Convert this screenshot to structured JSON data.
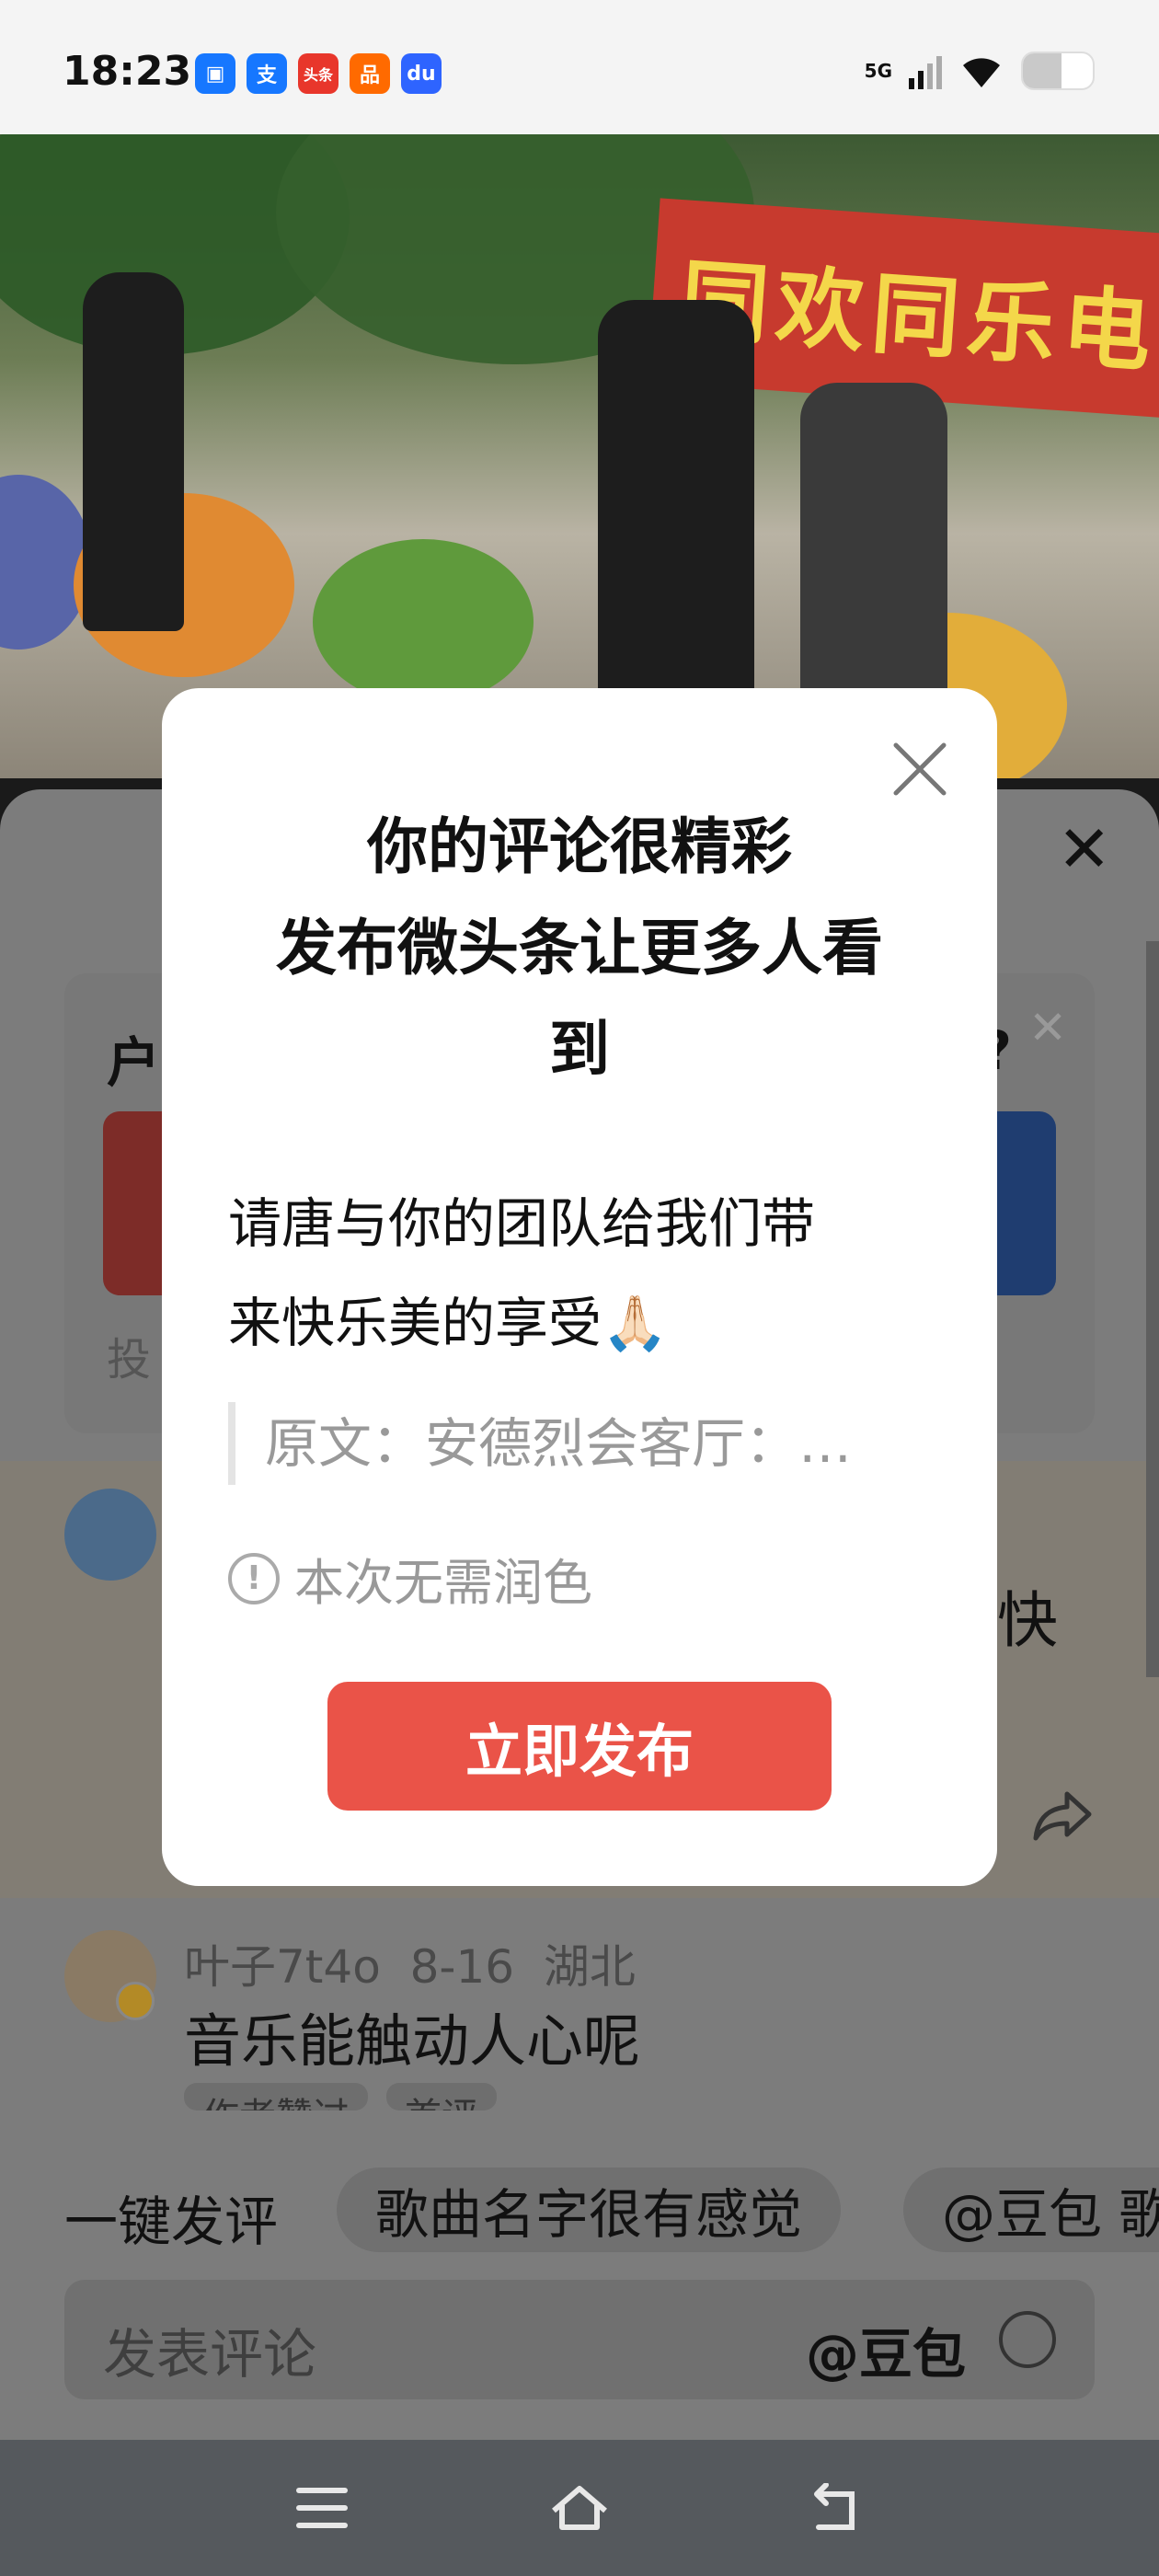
{
  "status_bar": {
    "time": "18:23",
    "apps": [
      {
        "icon": "nfc-app-icon",
        "glyph": "▣",
        "color": "#1677ff"
      },
      {
        "icon": "alipay-icon",
        "glyph": "支",
        "color": "#1677ff"
      },
      {
        "icon": "toutiao-icon",
        "glyph": "头条",
        "color": "#e8362b"
      },
      {
        "icon": "taobao-icon",
        "glyph": "品",
        "color": "#ff6a00"
      },
      {
        "icon": "baidu-icon",
        "glyph": "du",
        "color": "#2e64ff"
      }
    ],
    "network": "5G",
    "battery_level": 0.55
  },
  "video": {
    "banner_text": "同欢同乐电"
  },
  "poll": {
    "title": "户",
    "title_tail": "?",
    "footer": "投"
  },
  "comments": [
    {
      "text_tail": "快"
    },
    {
      "username": "叶子7t4o",
      "date": "8-16",
      "location": "湖北",
      "text": "音乐能触动人心呢",
      "tags": [
        "作者赞过",
        "首评"
      ]
    }
  ],
  "quick_comment": {
    "label": "一键发评",
    "chips": [
      "歌曲名字很有感觉",
      "@豆包 歌"
    ]
  },
  "input": {
    "placeholder": "发表评论",
    "doubao": "@豆包"
  },
  "modal": {
    "title_lines": [
      "你的评论很精彩",
      "发布微头条让更多人看",
      "到"
    ],
    "body_lines": [
      "请唐与你的团队给我们带",
      "来快乐美的享受🙏🏻"
    ],
    "quote": "原文：安德烈会客厅：…",
    "note": "本次无需润色",
    "publish_label": "立即发布"
  },
  "colors": {
    "accent_red": "#ea5348",
    "modal_bg": "#ffffff",
    "dim_overlay": "#7c7c7c"
  }
}
